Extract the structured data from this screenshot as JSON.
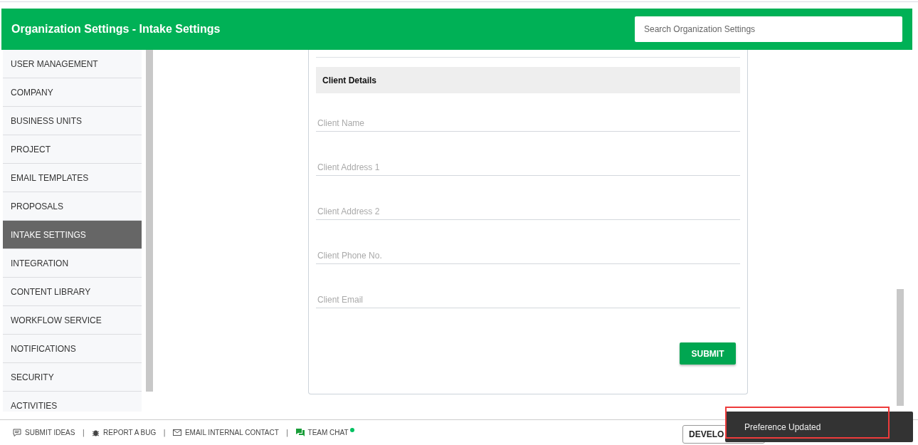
{
  "header": {
    "title": "Organization Settings - Intake Settings",
    "search": {
      "placeholder": "Search Organization Settings"
    }
  },
  "sidebar": {
    "items": [
      {
        "label": "USER MANAGEMENT",
        "selected": false
      },
      {
        "label": "COMPANY",
        "selected": false
      },
      {
        "label": "BUSINESS UNITS",
        "selected": false
      },
      {
        "label": "PROJECT",
        "selected": false
      },
      {
        "label": "EMAIL TEMPLATES",
        "selected": false
      },
      {
        "label": "PROPOSALS",
        "selected": false
      },
      {
        "label": "INTAKE SETTINGS",
        "selected": true
      },
      {
        "label": "INTEGRATION",
        "selected": false
      },
      {
        "label": "CONTENT LIBRARY",
        "selected": false
      },
      {
        "label": "WORKFLOW SERVICE",
        "selected": false
      },
      {
        "label": "NOTIFICATIONS",
        "selected": false
      },
      {
        "label": "SECURITY",
        "selected": false
      },
      {
        "label": "ACTIVITIES",
        "selected": false
      }
    ]
  },
  "form": {
    "section_title": "Client Details",
    "fields": [
      {
        "placeholder": "Client Name"
      },
      {
        "placeholder": "Client Address 1"
      },
      {
        "placeholder": "Client Address 2"
      },
      {
        "placeholder": "Client Phone No."
      },
      {
        "placeholder": "Client Email"
      }
    ],
    "submit": "SUBMIT"
  },
  "footer": {
    "links": [
      {
        "kind": "ideas",
        "label": "SUBMIT IDEAS"
      },
      {
        "kind": "bug",
        "label": "REPORT A BUG"
      },
      {
        "kind": "email",
        "label": "EMAIL INTERNAL CONTACT"
      },
      {
        "kind": "chat",
        "label": "TEAM CHAT",
        "online": true
      }
    ],
    "separator": "|",
    "environment_button": "DEVELO"
  },
  "toast": {
    "message": "Preference Updated",
    "highlighted": true
  }
}
